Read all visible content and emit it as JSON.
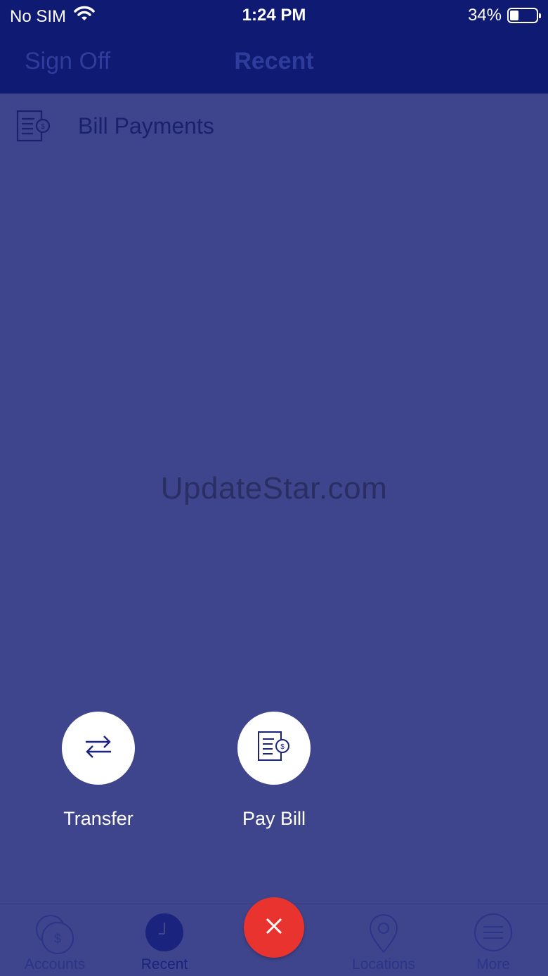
{
  "status_bar": {
    "carrier": "No SIM",
    "time": "1:24 PM",
    "battery_percent": "34%",
    "battery_level": 0.34
  },
  "nav_bar": {
    "sign_off_label": "Sign Off",
    "title": "Recent"
  },
  "list": {
    "items": [
      {
        "label": "Bill Payments",
        "icon": "bill-icon"
      }
    ]
  },
  "watermark": "UpdateStar.com",
  "actions": {
    "transfer_label": "Transfer",
    "pay_bill_label": "Pay Bill"
  },
  "tab_bar": {
    "items": [
      {
        "label": "Accounts",
        "icon": "accounts-icon"
      },
      {
        "label": "Recent",
        "icon": "clock-icon",
        "active": true
      },
      {
        "label": "",
        "icon": "close-icon"
      },
      {
        "label": "Locations",
        "icon": "location-pin-icon"
      },
      {
        "label": "More",
        "icon": "menu-icon"
      }
    ]
  },
  "colors": {
    "overlay_background": "#3f458c",
    "header_background": "#0f1a73",
    "close_button": "#e8332f"
  }
}
